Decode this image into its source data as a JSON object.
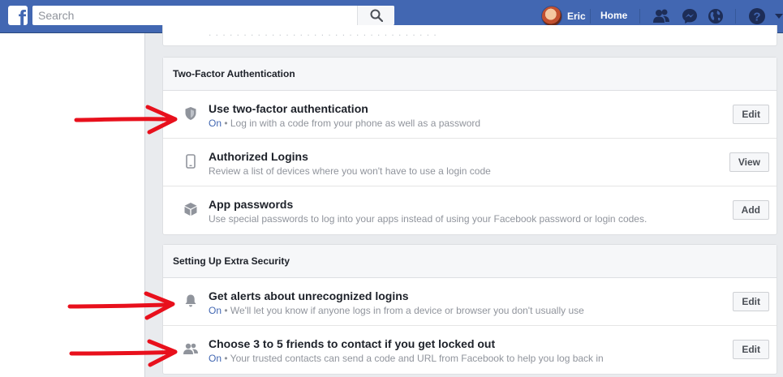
{
  "topbar": {
    "logo_letter": "f",
    "search_placeholder": "Search",
    "profile_name": "Eric",
    "home_label": "Home",
    "icons": [
      "friends-icon",
      "messenger-icon",
      "globe-icon",
      "help-icon",
      "dropdown-caret-icon"
    ]
  },
  "two_factor": {
    "header": "Two-Factor Authentication",
    "items": [
      {
        "title": "Use two-factor authentication",
        "status": "On",
        "description": " • Log in with a code from your phone as well as a password",
        "button": "Edit",
        "icon": "shield-icon"
      },
      {
        "title": "Authorized Logins",
        "description": "Review a list of devices where you won't have to use a login code",
        "button": "View",
        "icon": "phone-icon"
      },
      {
        "title": "App passwords",
        "description": "Use special passwords to log into your apps instead of using your Facebook password or login codes.",
        "button": "Add",
        "icon": "box-icon"
      }
    ]
  },
  "extra_security": {
    "header": "Setting Up Extra Security",
    "items": [
      {
        "title": "Get alerts about unrecognized logins",
        "status": "On",
        "description": " • We'll let you know if anyone logs in from a device or browser you don't usually use",
        "button": "Edit",
        "icon": "bell-icon"
      },
      {
        "title": "Choose 3 to 5 friends to contact if you get locked out",
        "status": "On",
        "description": " • Your trusted contacts can send a code and URL from Facebook to help you log back in",
        "button": "Edit",
        "icon": "friends-icon"
      }
    ]
  },
  "colors": {
    "brand_blue": "#4267b2",
    "annotation_red": "#e8101c",
    "status_on": "#4267b2"
  }
}
